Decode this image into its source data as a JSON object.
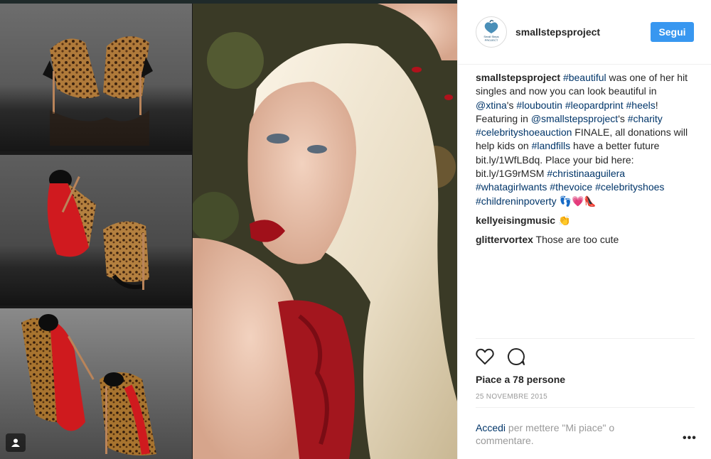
{
  "post": {
    "username": "smallstepsproject",
    "avatar_text": "Small Steps PROJECT",
    "follow_label": "Segui",
    "caption": {
      "user": "smallstepsproject",
      "parts": [
        {
          "t": " "
        },
        {
          "t": "#beautiful",
          "tag": true
        },
        {
          "t": " was one of her hit singles and now you can look beautiful in "
        },
        {
          "t": "@xtina",
          "tag": true
        },
        {
          "t": "'s "
        },
        {
          "t": "#louboutin",
          "tag": true
        },
        {
          "t": " "
        },
        {
          "t": "#leopardprint",
          "tag": true
        },
        {
          "t": " "
        },
        {
          "t": "#heels",
          "tag": true
        },
        {
          "t": "! Featuring in "
        },
        {
          "t": "@smallstepsproject",
          "tag": true
        },
        {
          "t": "'s "
        },
        {
          "t": "#charity",
          "tag": true
        },
        {
          "t": " "
        },
        {
          "t": "#celebrityshoeauction",
          "tag": true
        },
        {
          "t": " FINALE, all donations will help kids on "
        },
        {
          "t": "#landfills",
          "tag": true
        },
        {
          "t": " have a better future bit.ly/1WfLBdq. Place your bid here: bit.ly/1G9rMSM "
        },
        {
          "t": "#christinaaguilera",
          "tag": true
        },
        {
          "t": " "
        },
        {
          "t": "#whatagirlwants",
          "tag": true
        },
        {
          "t": " "
        },
        {
          "t": "#thevoice",
          "tag": true
        },
        {
          "t": " "
        },
        {
          "t": "#celebrityshoes",
          "tag": true
        },
        {
          "t": " "
        },
        {
          "t": "#childreninpoverty",
          "tag": true
        },
        {
          "t": " 👣💗👠"
        }
      ]
    },
    "comments": [
      {
        "user": "kellyeisingmusic",
        "text": " 👏"
      },
      {
        "user": "glittervortex",
        "text": " Those are too cute"
      }
    ],
    "likes_text": "Piace a 78 persone",
    "date": "25 NOVEMBRE 2015",
    "comment_prompt": {
      "link": "Accedi",
      "text": " per mettere \"Mi piace\" o commentare."
    },
    "more_label": "•••"
  },
  "icons": {
    "like": "heart-icon",
    "comment": "comment-bubble-icon",
    "multi": "user-tag-icon"
  },
  "colors": {
    "follow_button": "#3897f0",
    "tag_link": "#003569",
    "muted": "#999999"
  }
}
